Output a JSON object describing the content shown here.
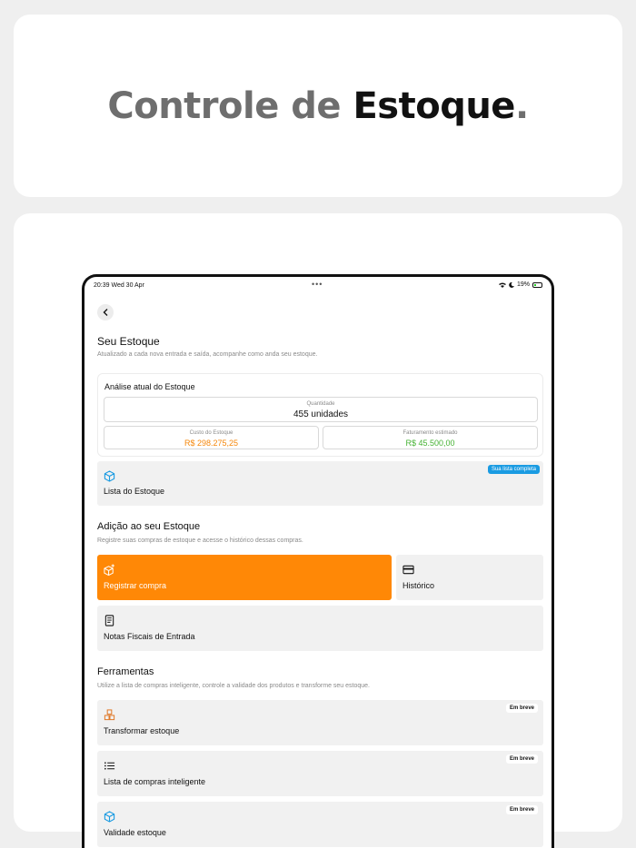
{
  "hero": {
    "part1": "Controle de ",
    "part2": "Estoque",
    "part3": "."
  },
  "status": {
    "time": "20:39  Wed 30 Apr",
    "dots": "•••",
    "battery": "19%"
  },
  "stock": {
    "title": "Seu Estoque",
    "subtitle": "Atualizado a cada nova entrada e saída, acompanhe como anda seu estoque.",
    "analysis_title": "Análise atual do Estoque",
    "quantity_label": "Quantidade",
    "quantity_value": "455 unidades",
    "cost_label": "Custo do Estoque",
    "cost_value": "R$ 298.275,25",
    "revenue_label": "Faturamento estimado",
    "revenue_value": "R$ 45.500,00",
    "list_label": "Lista do Estoque",
    "list_badge": "Sua lista completa"
  },
  "addition": {
    "title": "Adição ao seu Estoque",
    "subtitle": "Registre suas compras de estoque e acesse o histórico dessas compras.",
    "register_label": "Registrar compra",
    "history_label": "Histórico",
    "invoices_label": "Notas Fiscais de Entrada"
  },
  "tools": {
    "title": "Ferramentas",
    "subtitle": "Utilize a lista de compras inteligente, controle a validade dos produtos e transforme seu estoque.",
    "soon_label": "Em breve",
    "items": [
      "Transformar estoque",
      "Lista de compras inteligente",
      "Validade estoque"
    ]
  },
  "colors": {
    "accent_orange": "#ff8806",
    "badge_blue": "#1a9be2",
    "cost_orange": "#f5870b",
    "revenue_green": "#45b233"
  }
}
